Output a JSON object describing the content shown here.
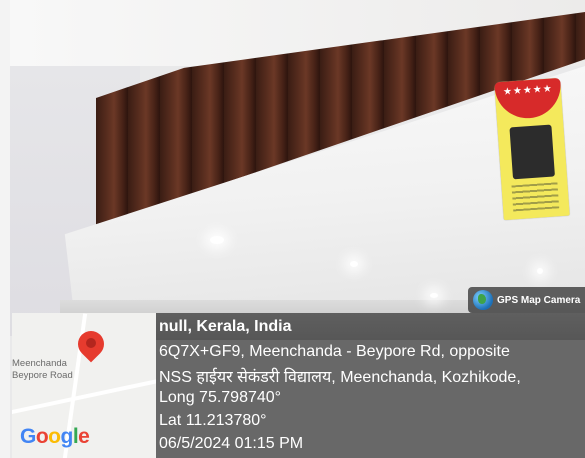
{
  "photo": {
    "description_hidden": ""
  },
  "energy_label": {
    "stars": "★★★★★",
    "caption": "POWER SAVINGS GUIDE"
  },
  "gps_badge": {
    "text": "GPS Map Camera"
  },
  "map": {
    "place_label_line1": "Meenchanda",
    "place_label_line2": "Beypore Road",
    "logo_letters": [
      "G",
      "o",
      "o",
      "g",
      "l",
      "e"
    ],
    "logo_colors": [
      "#4285F4",
      "#EA4335",
      "#FBBC05",
      "#4285F4",
      "#34A853",
      "#EA4335"
    ]
  },
  "info": {
    "title": "null, Kerala, India",
    "address_line1": "6Q7X+GF9, Meenchanda - Beypore Rd, opposite",
    "address_line2": "NSS हाईयर सेकंडरी विद्यालय, Meenchanda, Kozhikode,",
    "longitude": "Long 75.798740°",
    "latitude": "Lat 11.213780°",
    "datetime": "06/5/2024 01:15 PM"
  }
}
